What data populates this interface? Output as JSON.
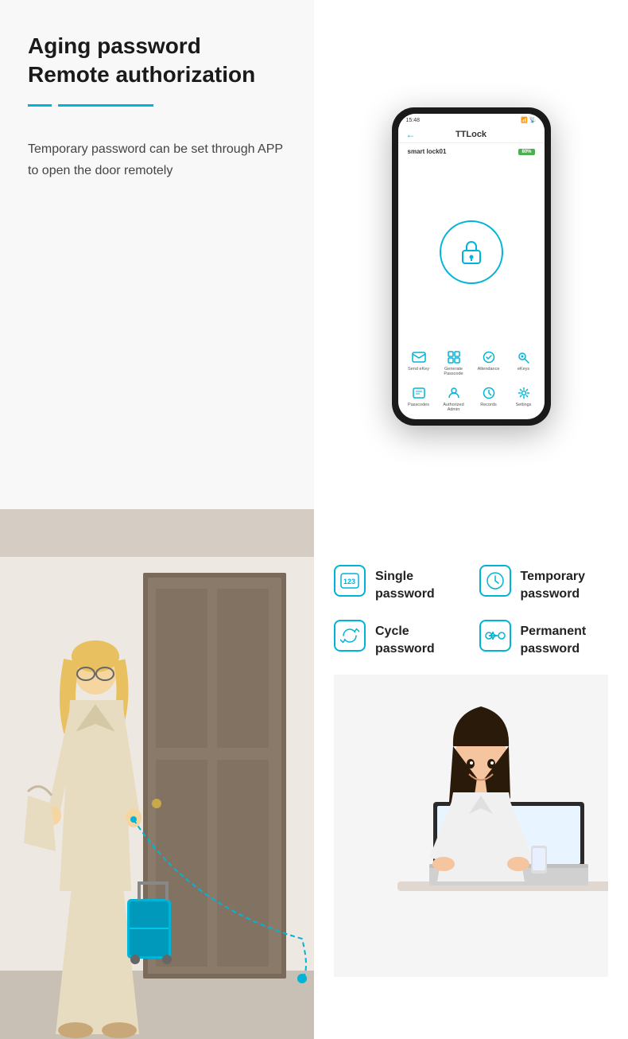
{
  "header": {
    "title": "Aging password Remote authorization",
    "description": "Temporary password can be set through APP to open the door remotely"
  },
  "phone": {
    "status_time": "15:48",
    "app_name": "TTLock",
    "device_name": "smart lock01",
    "battery_label": "80%",
    "icons": [
      {
        "label": "Send eKey",
        "icon": "email"
      },
      {
        "label": "Generate Passcode",
        "icon": "grid"
      },
      {
        "label": "Attendance",
        "icon": "check-circle"
      },
      {
        "label": "eKeys",
        "icon": "key"
      },
      {
        "label": "Passcodes",
        "icon": "grid-small"
      },
      {
        "label": "Authorized Admin",
        "icon": "person"
      },
      {
        "label": "Records",
        "icon": "clock"
      },
      {
        "label": "Settings",
        "icon": "gear"
      }
    ]
  },
  "password_types": [
    {
      "icon": "123",
      "label": "Single password",
      "icon_type": "number"
    },
    {
      "icon": "clock",
      "label": "Temporary password",
      "icon_type": "clock"
    },
    {
      "icon": "cycle",
      "label": "Cycle password",
      "icon_type": "cycle"
    },
    {
      "icon": "infinity",
      "label": "Permanent password",
      "icon_type": "infinity"
    }
  ],
  "colors": {
    "accent": "#00b4d8",
    "text_dark": "#1a1a1a",
    "text_gray": "#444444",
    "bg_light": "#f8f8f8"
  }
}
